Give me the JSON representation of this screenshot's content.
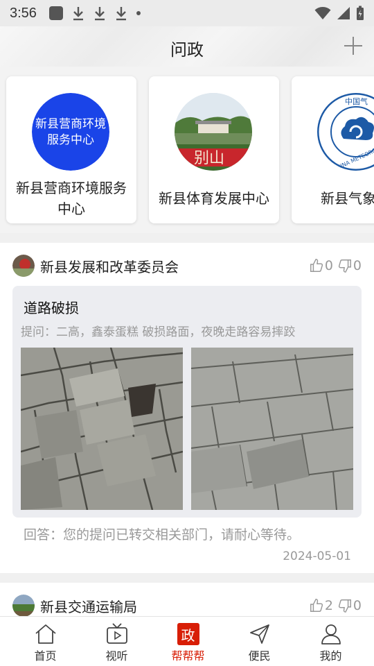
{
  "status_bar": {
    "time": "3:56"
  },
  "header": {
    "title": "问政"
  },
  "organizations": [
    {
      "name": "新县营商环境服务中心",
      "logo_text": "新县营商环境服务中心"
    },
    {
      "name": "新县体育发展中心",
      "photo_caption": "别山"
    },
    {
      "name": "新县气象",
      "seal_text": "中国气 CHINA METEORO"
    }
  ],
  "posts": [
    {
      "department": "新县发展和改革委员会",
      "likes": "0",
      "dislikes": "0",
      "question_title": "道路破损",
      "question_text": "提问：二高，鑫泰蛋糕 破损路面，夜晚走路容易摔跤",
      "answer": "回答：您的提问已转交相关部门，请耐心等待。",
      "date": "2024-05-01"
    },
    {
      "department": "新县交通运输局",
      "likes": "2",
      "dislikes": "0"
    }
  ],
  "tabs": [
    {
      "label": "首页",
      "icon": "home-icon"
    },
    {
      "label": "视听",
      "icon": "tv-play-icon"
    },
    {
      "label": "帮帮帮",
      "icon": "zheng-icon",
      "glyph": "政",
      "active": true
    },
    {
      "label": "便民",
      "icon": "send-icon"
    },
    {
      "label": "我的",
      "icon": "user-icon"
    }
  ],
  "colors": {
    "accent": "#d81e06",
    "card_logo_blue": "#1a44e8",
    "muted_text": "#999999"
  }
}
